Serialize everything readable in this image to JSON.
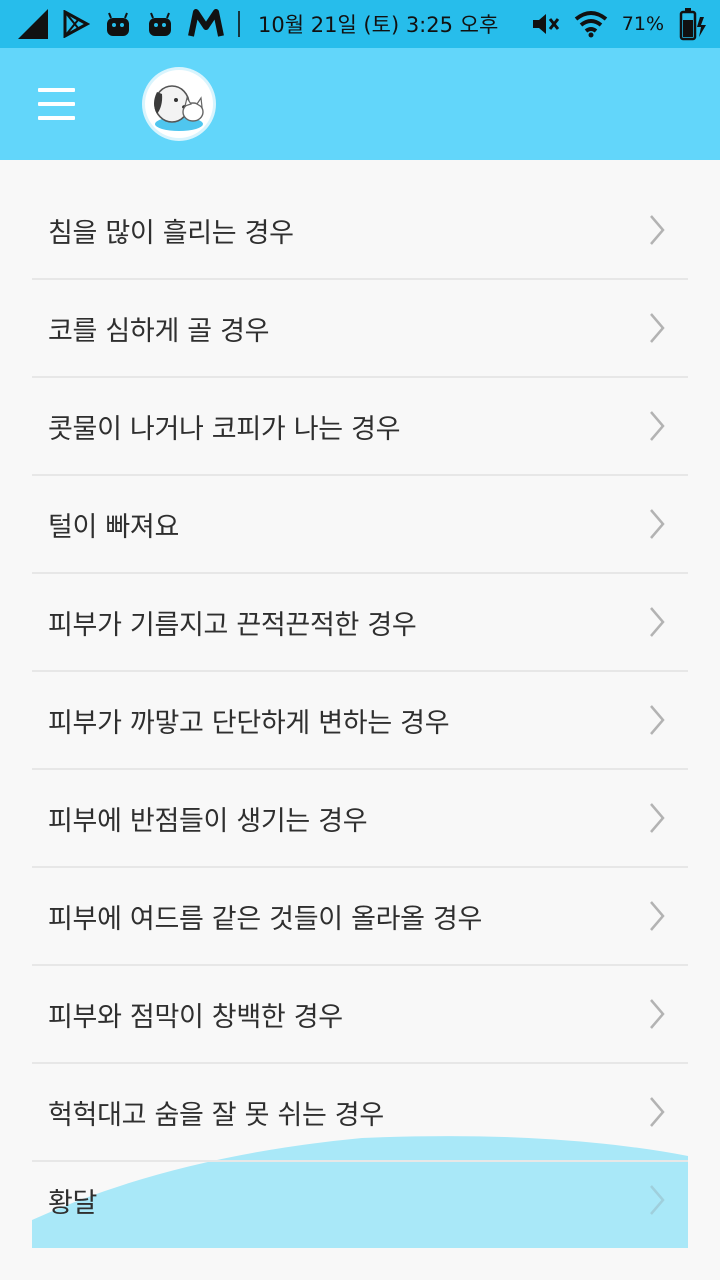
{
  "status_bar": {
    "date_time": "10월 21일 (토) 3:25 오후",
    "battery": "71%"
  },
  "app_bar": {
    "menu_icon": "hamburger-menu-icon",
    "logo_icon": "dog-cat-logo-icon"
  },
  "colors": {
    "status_bar": "#27bdeb",
    "app_bar": "#62d6fa",
    "wave": "#a9e8f8"
  },
  "symptoms": [
    {
      "label": "침을 많이 흘리는 경우"
    },
    {
      "label": "코를 심하게 골 경우"
    },
    {
      "label": "콧물이 나거나 코피가 나는 경우"
    },
    {
      "label": "털이 빠져요"
    },
    {
      "label": "피부가 기름지고 끈적끈적한 경우"
    },
    {
      "label": "피부가 까맣고 단단하게 변하는 경우"
    },
    {
      "label": "피부에 반점들이 생기는 경우"
    },
    {
      "label": "피부에 여드름 같은 것들이 올라올 경우"
    },
    {
      "label": "피부와 점막이 창백한 경우"
    },
    {
      "label": "헉헉대고 숨을 잘 못 쉬는 경우"
    },
    {
      "label": "황달"
    }
  ]
}
